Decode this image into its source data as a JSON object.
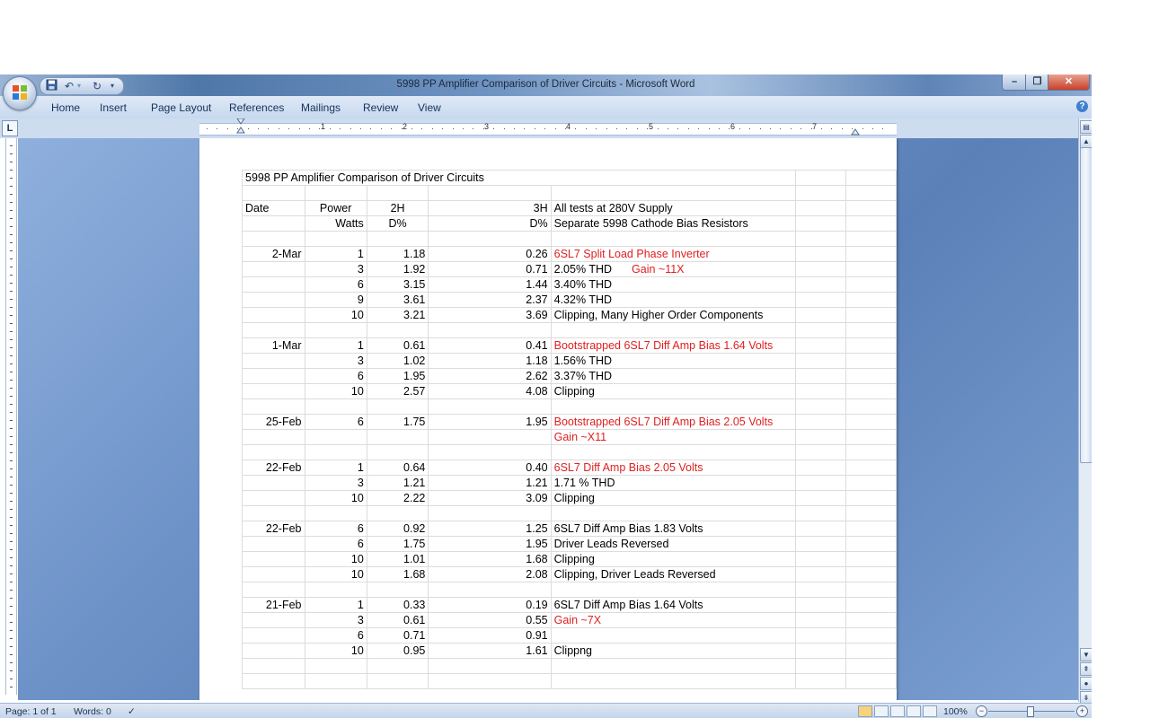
{
  "window": {
    "title": "5998 PP Amplifier Comparison of Driver Circuits - Microsoft Word"
  },
  "ribbon": {
    "tabs": [
      "Home",
      "Insert",
      "Page Layout",
      "References",
      "Mailings",
      "Review",
      "View"
    ]
  },
  "ruler": {
    "numbers": [
      "1",
      "2",
      "3",
      "4",
      "5",
      "6",
      "7"
    ]
  },
  "document": {
    "title": "5998 PP Amplifier Comparison of Driver Circuits",
    "header1": {
      "date": "Date",
      "power": "Power",
      "h2": "2H",
      "h3": "3H",
      "note": "All tests at 280V Supply"
    },
    "header2": {
      "power": "Watts",
      "h2": "D%",
      "h3": "D%",
      "note": "Separate 5998 Cathode Bias Resistors"
    },
    "rows": [
      {
        "date": "",
        "power": "",
        "h2": "",
        "h3": "",
        "note": "",
        "note_red": false
      },
      {
        "date": "2-Mar",
        "power": "1",
        "h2": "1.18",
        "h3": "0.26",
        "note": "6SL7 Split Load Phase Inverter",
        "note_red": true
      },
      {
        "date": "",
        "power": "3",
        "h2": "1.92",
        "h3": "0.71",
        "note": "2.05% THD",
        "note_red": false,
        "extra": "Gain ~11X"
      },
      {
        "date": "",
        "power": "6",
        "h2": "3.15",
        "h3": "1.44",
        "note": "3.40% THD",
        "note_red": false
      },
      {
        "date": "",
        "power": "9",
        "h2": "3.61",
        "h3": "2.37",
        "note": "4.32% THD",
        "note_red": false
      },
      {
        "date": "",
        "power": "10",
        "h2": "3.21",
        "h3": "3.69",
        "note": "Clipping, Many Higher Order Components",
        "note_red": false
      },
      {
        "date": "",
        "power": "",
        "h2": "",
        "h3": "",
        "note": "",
        "note_red": false
      },
      {
        "date": "1-Mar",
        "power": "1",
        "h2": "0.61",
        "h3": "0.41",
        "note": "Bootstrapped 6SL7 Diff Amp Bias 1.64 Volts",
        "note_red": true
      },
      {
        "date": "",
        "power": "3",
        "h2": "1.02",
        "h3": "1.18",
        "note": "1.56% THD",
        "note_red": false
      },
      {
        "date": "",
        "power": "6",
        "h2": "1.95",
        "h3": "2.62",
        "note": "3.37% THD",
        "note_red": false
      },
      {
        "date": "",
        "power": "10",
        "h2": "2.57",
        "h3": "4.08",
        "note": "Clipping",
        "note_red": false
      },
      {
        "date": "",
        "power": "",
        "h2": "",
        "h3": "",
        "note": "",
        "note_red": false
      },
      {
        "date": "25-Feb",
        "power": "6",
        "h2": "1.75",
        "h3": "1.95",
        "note": "Bootstrapped 6SL7 Diff Amp Bias 2.05 Volts",
        "note_red": true
      },
      {
        "date": "",
        "power": "",
        "h2": "",
        "h3": "",
        "note": "Gain ~X11",
        "note_red": true
      },
      {
        "date": "",
        "power": "",
        "h2": "",
        "h3": "",
        "note": "",
        "note_red": false
      },
      {
        "date": "22-Feb",
        "power": "1",
        "h2": "0.64",
        "h3": "0.40",
        "note": "6SL7 Diff Amp Bias 2.05 Volts",
        "note_red": true
      },
      {
        "date": "",
        "power": "3",
        "h2": "1.21",
        "h3": "1.21",
        "note": "1.71 % THD",
        "note_red": false
      },
      {
        "date": "",
        "power": "10",
        "h2": "2.22",
        "h3": "3.09",
        "note": "Clipping",
        "note_red": false
      },
      {
        "date": "",
        "power": "",
        "h2": "",
        "h3": "",
        "note": "",
        "note_red": false
      },
      {
        "date": "22-Feb",
        "power": "6",
        "h2": "0.92",
        "h3": "1.25",
        "note": "6SL7 Diff Amp Bias 1.83 Volts",
        "note_red": false
      },
      {
        "date": "",
        "power": "6",
        "h2": "1.75",
        "h3": "1.95",
        "note": "Driver Leads Reversed",
        "note_red": false
      },
      {
        "date": "",
        "power": "10",
        "h2": "1.01",
        "h3": "1.68",
        "note": "Clipping",
        "note_red": false
      },
      {
        "date": "",
        "power": "10",
        "h2": "1.68",
        "h3": "2.08",
        "note": "Clipping, Driver Leads Reversed",
        "note_red": false
      },
      {
        "date": "",
        "power": "",
        "h2": "",
        "h3": "",
        "note": "",
        "note_red": false
      },
      {
        "date": "21-Feb",
        "power": "1",
        "h2": "0.33",
        "h3": "0.19",
        "note": "6SL7 Diff Amp Bias 1.64 Volts",
        "note_red": false
      },
      {
        "date": "",
        "power": "3",
        "h2": "0.61",
        "h3": "0.55",
        "note": "Gain ~7X",
        "note_red": true
      },
      {
        "date": "",
        "power": "6",
        "h2": "0.71",
        "h3": "0.91",
        "note": "",
        "note_red": false
      },
      {
        "date": "",
        "power": "10",
        "h2": "0.95",
        "h3": "1.61",
        "note": "Clippng",
        "note_red": false
      },
      {
        "date": "",
        "power": "",
        "h2": "",
        "h3": "",
        "note": "",
        "note_red": false
      },
      {
        "date": "",
        "power": "",
        "h2": "",
        "h3": "",
        "note": "",
        "note_red": false
      }
    ]
  },
  "statusbar": {
    "page": "Page: 1 of 1",
    "words": "Words: 0",
    "zoom": "100%"
  },
  "colors": {
    "accent_red": "#e02020",
    "ribbon_bg": "#c7d9ef",
    "doc_background": "#6d92c8"
  }
}
